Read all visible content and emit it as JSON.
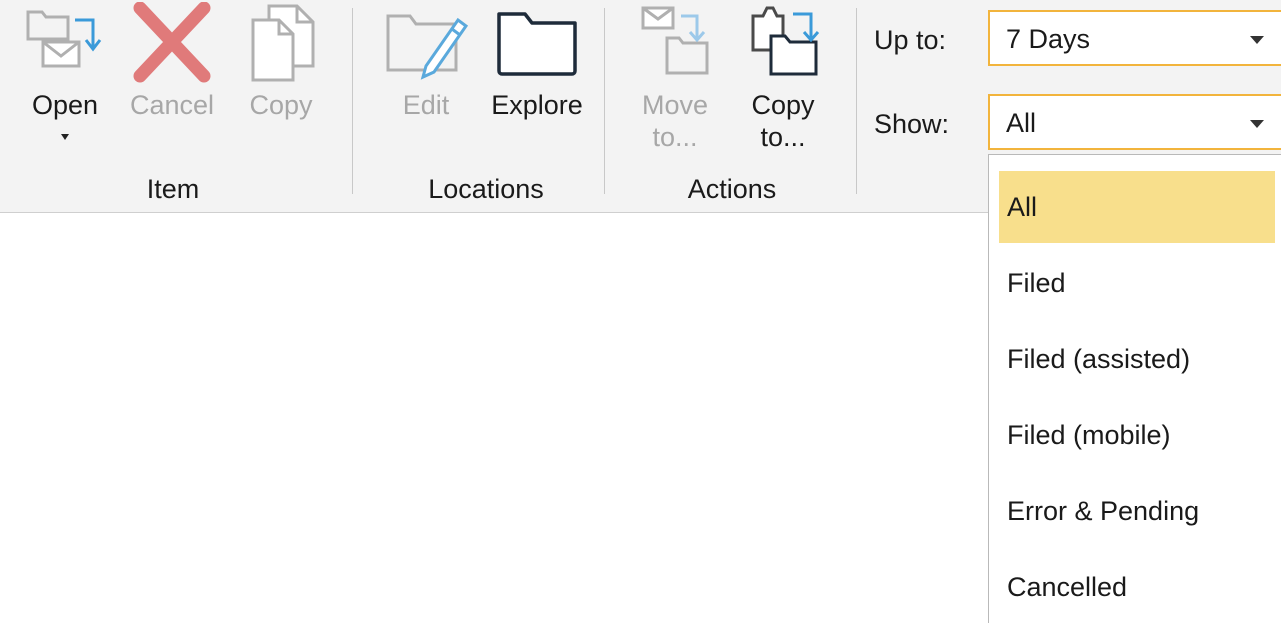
{
  "ribbon": {
    "groups": {
      "item": "Item",
      "locations": "Locations",
      "actions": "Actions"
    },
    "buttons": {
      "open": "Open",
      "cancel": "Cancel",
      "copy": "Copy",
      "edit": "Edit",
      "explore": "Explore",
      "move_to_1": "Move",
      "move_to_2": "to...",
      "copy_to_1": "Copy",
      "copy_to_2": "to..."
    }
  },
  "filters": {
    "up_to_label": "Up to:",
    "up_to_value": "7 Days",
    "show_label": "Show:",
    "show_value": "All"
  },
  "dropdown": {
    "options": [
      "All",
      "Filed",
      "Filed (assisted)",
      "Filed (mobile)",
      "Error & Pending",
      "Cancelled"
    ],
    "selected_index": 0
  },
  "colors": {
    "highlight": "#f8df8c",
    "combo_border": "#f2b43c",
    "cancel_red": "#e07a7a",
    "accent_blue": "#3a9ad9"
  }
}
